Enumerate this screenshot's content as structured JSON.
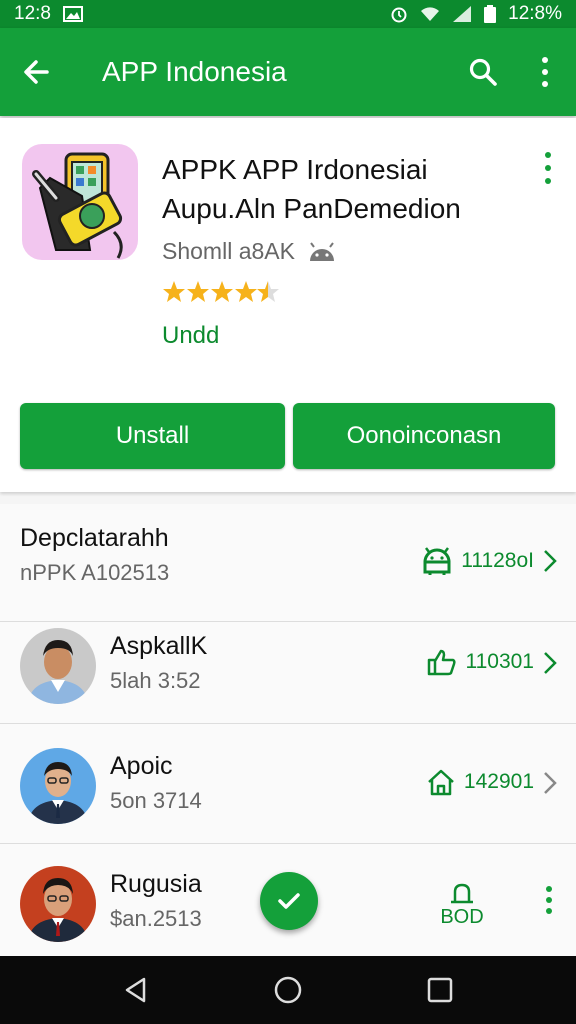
{
  "status_bar": {
    "time_left": "12:8",
    "time_right": "12:8%"
  },
  "app_bar": {
    "title": "APP Indonesia"
  },
  "app": {
    "name": "APPK APP Irdonesiai Aupu.Aln PanDemedion",
    "developer": "Shomll a8AK",
    "rating": 4.5,
    "update_label": "Undd",
    "primary_button": "Unstall",
    "secondary_button": "Oonoinconasn"
  },
  "list": {
    "header": {
      "title": "Depclatarahh",
      "subtitle": "nPPK A102513",
      "stat": "11128oI"
    },
    "items": [
      {
        "name": "AspkallK",
        "sub": "5lah 3:52",
        "stat": "110301"
      },
      {
        "name": "Apoic",
        "sub": "5on 3714",
        "stat": "142901"
      },
      {
        "name": "Rugusia",
        "sub": "$an.2513",
        "action_label": "BOD"
      }
    ]
  },
  "colors": {
    "primary": "#14a03a",
    "primary_dark": "#0c8a2e",
    "accent_text": "#0c8a2e",
    "star": "#f6b21b"
  }
}
